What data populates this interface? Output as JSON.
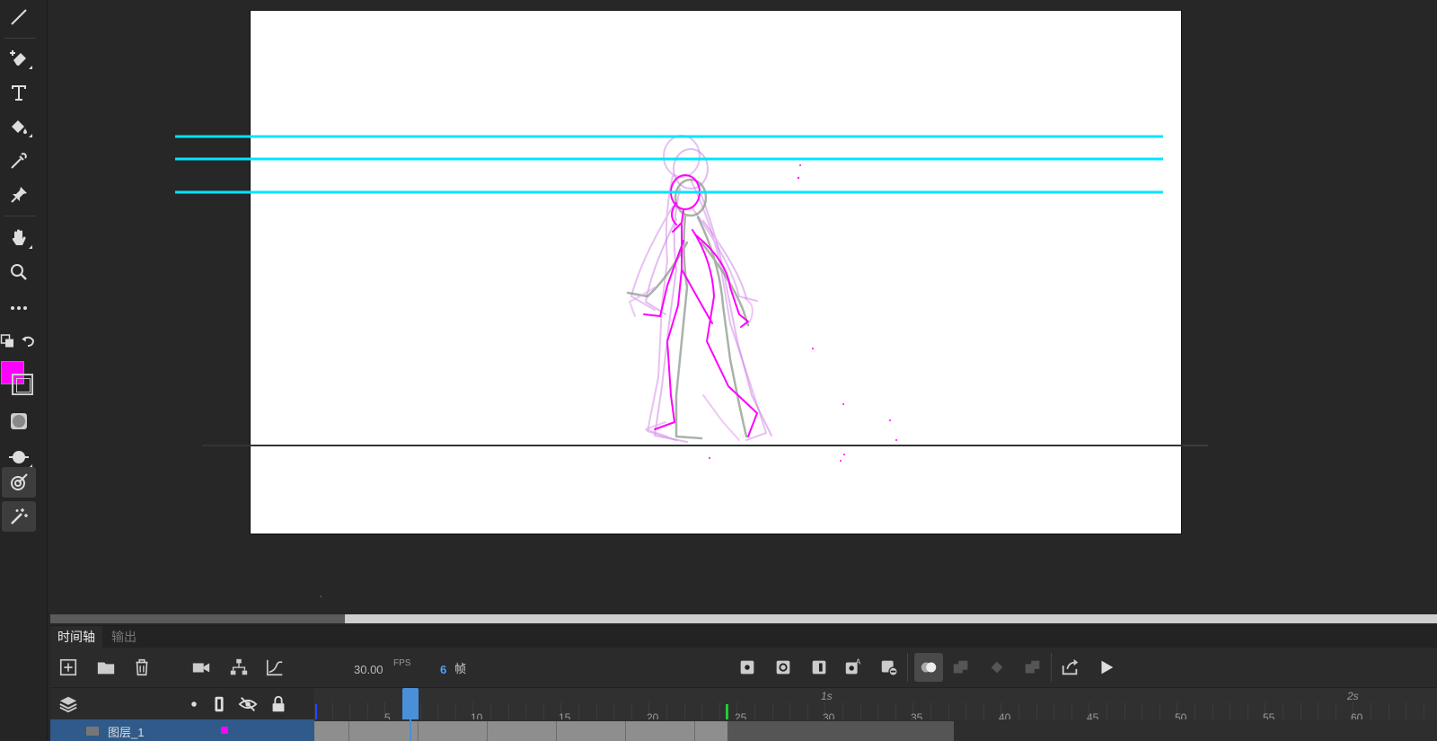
{
  "colors": {
    "fill": "#ff00ff",
    "guide": "#00e5ff",
    "playhead": "#4a90d9"
  },
  "toolbar": {
    "tools": [
      "line-tool",
      "pen-tool",
      "text-tool",
      "paint-bucket-tool",
      "eyedropper-tool",
      "pin-tool",
      "hand-tool",
      "zoom-tool",
      "more-tools",
      "swap-colors",
      "default-colors",
      "fill-color",
      "stroke-color",
      "object-drawing",
      "brush-mode",
      "asset-warp-tool",
      "magic-wand-tool"
    ]
  },
  "timeline": {
    "tabs": [
      "时间轴",
      "输出"
    ],
    "fps_value": "30.00",
    "fps_unit": "FPS",
    "frame_value": "6",
    "frame_unit": "帧",
    "frame_numbers": [
      "5",
      "10",
      "15",
      "20",
      "25",
      "30",
      "35",
      "40",
      "45",
      "50",
      "55",
      "60"
    ],
    "seconds": [
      "1s",
      "2s"
    ],
    "current_frame": 6,
    "layer_name": "图层_1"
  }
}
